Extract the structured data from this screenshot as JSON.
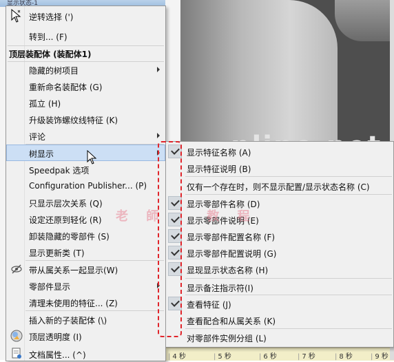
{
  "background": {
    "window_title": "显示状态-1",
    "site_watermark": "nline.net",
    "timeline": [
      "4 秒",
      "5 秒",
      "6 秒",
      "7 秒",
      "8 秒",
      "9 秒"
    ],
    "brand_watermark": [
      "老 師",
      "教 程"
    ]
  },
  "context_menu": {
    "items": [
      {
        "label": "逆转选择 (')"
      },
      {
        "label": "转到... (F)"
      },
      {
        "label": "顶层装配体 (装配体1)"
      },
      {
        "label": "隐藏的树项目"
      },
      {
        "label": "重新命名装配体 (G)"
      },
      {
        "label": "孤立 (H)"
      },
      {
        "label": "升级装饰螺纹线特征 (K)"
      },
      {
        "label": "评论"
      },
      {
        "label": "树显示"
      },
      {
        "label": "Speedpak 选项"
      },
      {
        "label": "Configuration Publisher... (P)"
      },
      {
        "label": "只显示层次关系 (Q)"
      },
      {
        "label": "设定还原到轻化 (R)"
      },
      {
        "label": "卸装隐藏的零部件 (S)"
      },
      {
        "label": "显示更新类 (T)"
      },
      {
        "label": "带从属关系一起显示(W)"
      },
      {
        "label": "零部件显示"
      },
      {
        "label": "清理未使用的特征... (Z)"
      },
      {
        "label": "插入新的子装配体 (\\)"
      },
      {
        "label": "顶层透明度 (I)"
      },
      {
        "label": "文档属性... (^)"
      }
    ]
  },
  "tree_display_submenu": {
    "items": [
      {
        "label": "显示特征名称 (A)",
        "checked": true
      },
      {
        "label": "显示特征说明 (B)",
        "checked": false
      },
      {
        "label": "仅有一个存在时，则不显示配置/显示状态名称 (C)",
        "checked": false
      },
      {
        "label": "显示零部件名称 (D)",
        "checked": true
      },
      {
        "label": "显示零部件说明 (E)",
        "checked": true
      },
      {
        "label": "显示零部件配置名称 (F)",
        "checked": true
      },
      {
        "label": "显示零部件配置说明 (G)",
        "checked": true
      },
      {
        "label": "显现显示状态名称 (H)",
        "checked": true
      },
      {
        "label": "显示备注指示符(I)",
        "checked": false
      },
      {
        "label": "查看特征 (J)",
        "checked": true
      },
      {
        "label": "查看配合和从属关系 (K)",
        "checked": false
      },
      {
        "label": "对零部件实例分组 (L)",
        "checked": false
      }
    ]
  },
  "colors": {
    "menu_bg": "#f0f0f0",
    "highlight": "#ccdff5",
    "annotation_red": "#e0242a"
  }
}
